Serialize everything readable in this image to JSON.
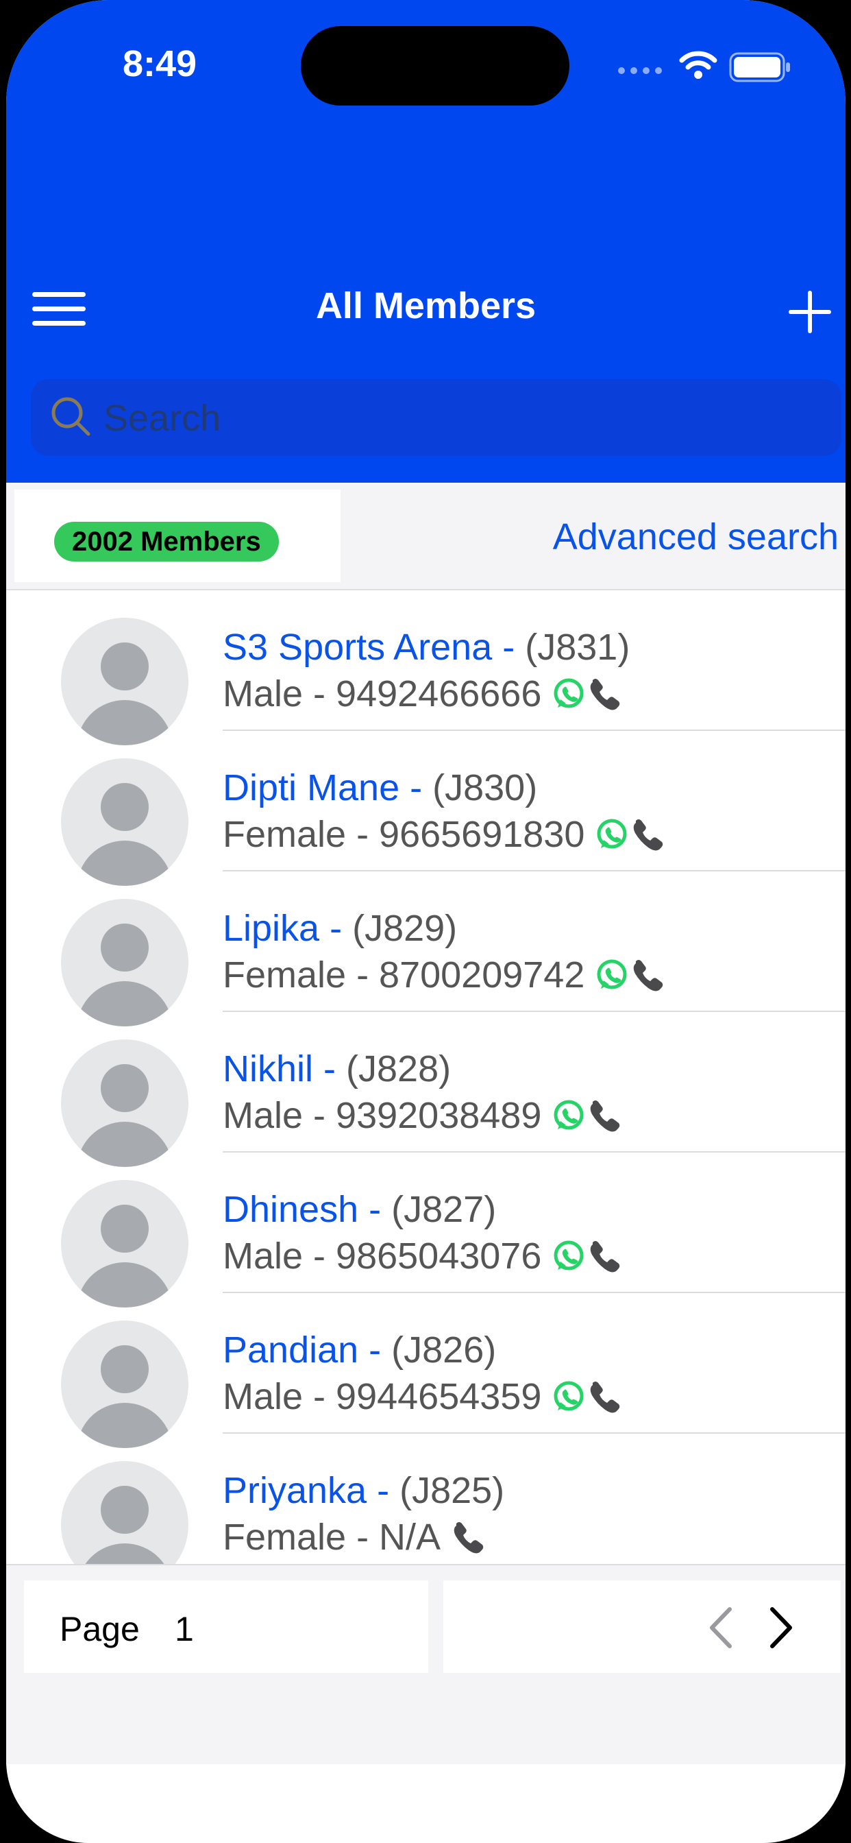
{
  "status_bar": {
    "time": "8:49"
  },
  "header": {
    "title": "All Members"
  },
  "search": {
    "placeholder": "Search"
  },
  "filter": {
    "count_label": "2002 Members",
    "advanced_search_label": "Advanced search"
  },
  "members": [
    {
      "name": "S3 Sports Arena - ",
      "code": "(J831)",
      "detail": "Male - 9492466666",
      "whatsapp": true
    },
    {
      "name": "Dipti Mane - ",
      "code": "(J830)",
      "detail": "Female - 9665691830",
      "whatsapp": true
    },
    {
      "name": "Lipika - ",
      "code": "(J829)",
      "detail": "Female - 8700209742",
      "whatsapp": true
    },
    {
      "name": "Nikhil - ",
      "code": "(J828)",
      "detail": "Male - 9392038489",
      "whatsapp": true
    },
    {
      "name": "Dhinesh - ",
      "code": "(J827)",
      "detail": "Male - 9865043076",
      "whatsapp": true
    },
    {
      "name": "Pandian - ",
      "code": "(J826)",
      "detail": "Male - 9944654359",
      "whatsapp": true
    },
    {
      "name": "Priyanka - ",
      "code": "(J825)",
      "detail": "Female - N/A",
      "whatsapp": false
    }
  ],
  "pagination": {
    "label": "Page",
    "current_page": "1"
  },
  "icons": {
    "menu": "hamburger-menu-icon",
    "add": "plus-icon",
    "search": "magnifier-icon",
    "whatsapp": "whatsapp-icon",
    "phone": "phone-icon",
    "prev": "chevron-left-icon",
    "next": "chevron-right-icon"
  },
  "colors": {
    "header": "#0047f0",
    "accent": "#0a53e8",
    "badge": "#35c85a",
    "whatsapp": "#25d366"
  }
}
